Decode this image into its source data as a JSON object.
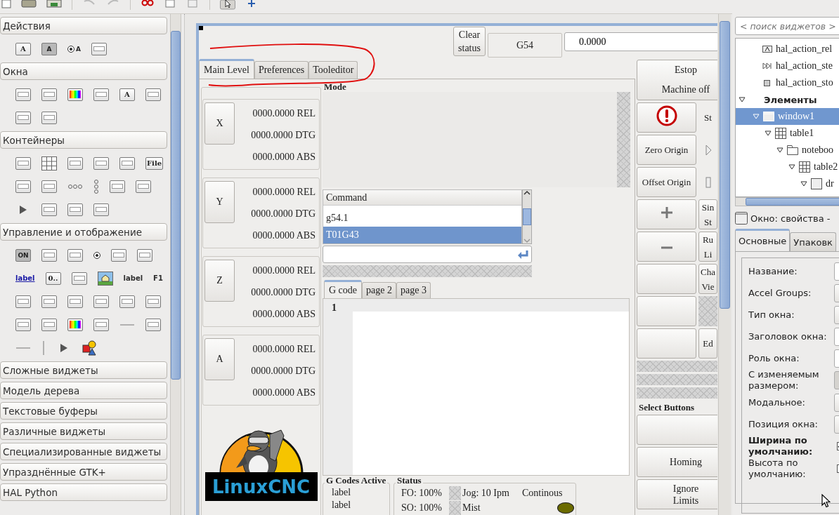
{
  "palette": {
    "groups": [
      {
        "title": "Действия",
        "rows": [
          [
            {
              "kind": "letter",
              "text": "A"
            },
            {
              "kind": "letter-shaded",
              "text": "A"
            },
            {
              "kind": "radio",
              "text": "A"
            },
            {
              "kind": "frame"
            }
          ]
        ]
      },
      {
        "title": "Окна",
        "rows": [
          [
            {
              "kind": "frame"
            },
            {
              "kind": "frame"
            },
            {
              "kind": "colors"
            },
            {
              "kind": "frame"
            },
            {
              "kind": "letter",
              "text": "A"
            },
            {
              "kind": "frame"
            }
          ],
          [
            {
              "kind": "frame"
            },
            {
              "kind": "frame"
            }
          ]
        ]
      },
      {
        "title": "Контейнеры",
        "rows": [
          [
            {
              "kind": "frame"
            },
            {
              "kind": "grid"
            },
            {
              "kind": "frame"
            },
            {
              "kind": "frame"
            },
            {
              "kind": "frame"
            },
            {
              "kind": "letter",
              "text": "File"
            }
          ],
          [
            {
              "kind": "frame"
            },
            {
              "kind": "frame"
            },
            {
              "kind": "dots"
            },
            {
              "kind": "vdots"
            },
            {
              "kind": "frame"
            },
            {
              "kind": "frame"
            }
          ],
          [
            {
              "kind": "arrow"
            },
            {
              "kind": "frame"
            },
            {
              "kind": "frame"
            },
            {
              "kind": "frame"
            }
          ]
        ]
      },
      {
        "title": "Управление и отображение",
        "rows": [
          [
            {
              "kind": "letter-shaded",
              "text": "ON"
            },
            {
              "kind": "frame"
            },
            {
              "kind": "frame"
            },
            {
              "kind": "radio",
              "text": ""
            },
            {
              "kind": "frame"
            },
            {
              "kind": "frame"
            }
          ],
          [
            {
              "kind": "link",
              "text": "label"
            },
            {
              "kind": "letter",
              "text": "0.."
            },
            {
              "kind": "frame"
            },
            {
              "kind": "image"
            },
            {
              "kind": "plain",
              "text": "label"
            },
            {
              "kind": "plain",
              "text": "F1"
            }
          ],
          [
            {
              "kind": "frame"
            },
            {
              "kind": "frame"
            },
            {
              "kind": "frame"
            },
            {
              "kind": "frame"
            },
            {
              "kind": "frame"
            },
            {
              "kind": "frame"
            }
          ],
          [
            {
              "kind": "frame"
            },
            {
              "kind": "frame"
            },
            {
              "kind": "colors"
            },
            {
              "kind": "frame"
            },
            {
              "kind": "hline"
            },
            {
              "kind": "frame"
            }
          ],
          [
            {
              "kind": "hline"
            },
            {
              "kind": "vline"
            },
            {
              "kind": "arrow"
            },
            {
              "kind": "shapes"
            }
          ]
        ]
      },
      {
        "title": "Сложные виджеты"
      },
      {
        "title": "Модель дерева"
      },
      {
        "title": "Текстовые буферы"
      },
      {
        "title": "Различные виджеты"
      },
      {
        "title": "Специализированные виджеты"
      },
      {
        "title": "Упразднённые GTK+"
      },
      {
        "title": "HAL Python"
      }
    ]
  },
  "cnc": {
    "clear_status": "Clear status",
    "coordinate_system": "G54",
    "value": "0.0000",
    "tabs": [
      {
        "label": "Main Level",
        "selected": true
      },
      {
        "label": "Preferences",
        "selected": false
      },
      {
        "label": "Tooleditor",
        "selected": false
      }
    ],
    "axes": [
      {
        "name": "X",
        "readings": [
          {
            "value": "0000.0000",
            "unit": "REL"
          },
          {
            "value": "0000.0000",
            "unit": "DTG"
          },
          {
            "value": "0000.0000",
            "unit": "ABS"
          }
        ]
      },
      {
        "name": "Y",
        "readings": [
          {
            "value": "0000.0000",
            "unit": "REL"
          },
          {
            "value": "0000.0000",
            "unit": "DTG"
          },
          {
            "value": "0000.0000",
            "unit": "ABS"
          }
        ]
      },
      {
        "name": "Z",
        "readings": [
          {
            "value": "0000.0000",
            "unit": "REL"
          },
          {
            "value": "0000.0000",
            "unit": "DTG"
          },
          {
            "value": "0000.0000",
            "unit": "ABS"
          }
        ]
      },
      {
        "name": "A",
        "readings": [
          {
            "value": "0000.0000",
            "unit": "REL"
          },
          {
            "value": "0000.0000",
            "unit": "DTG"
          },
          {
            "value": "0000.0000",
            "unit": "ABS"
          }
        ]
      }
    ],
    "logo": "LinuxCNC",
    "mode_title": "Mode",
    "command": {
      "header": "Command",
      "rows": [
        {
          "text": "g54.1",
          "selected": false
        },
        {
          "text": "T01G43",
          "selected": true
        }
      ]
    },
    "editor_tabs": [
      {
        "label": "G code",
        "selected": true
      },
      {
        "label": "page 2",
        "selected": false
      },
      {
        "label": "page 3",
        "selected": false
      }
    ],
    "line_numbers": [
      "1"
    ],
    "gcodes_active": {
      "title": "G Codes Active",
      "labels": [
        "label",
        "label"
      ]
    },
    "status": {
      "title": "Status",
      "fo": "FO: 100%",
      "so": "SO: 100%",
      "jog": "Jog: 10 Ipm",
      "jog_mode": "Continous",
      "mist": {
        "label": "Mist",
        "color": "#6b6b00"
      }
    },
    "estop": {
      "lines": [
        "Estop",
        "Machine off"
      ]
    },
    "side_rows": [
      {
        "main": {
          "kind": "alert"
        },
        "side": {
          "kind": "label",
          "text": "St"
        }
      },
      {
        "main": {
          "kind": "button",
          "lines": [
            "Zero Origin"
          ]
        },
        "side": {
          "kind": "play"
        }
      },
      {
        "main": {
          "kind": "button",
          "lines": [
            "Offset Origin"
          ]
        },
        "side": {
          "kind": "pause"
        }
      },
      {
        "main": {
          "kind": "plus"
        },
        "side": {
          "kind": "button",
          "lines": [
            "Sin",
            "St"
          ]
        }
      },
      {
        "main": {
          "kind": "minus"
        },
        "side": {
          "kind": "button",
          "lines": [
            "Ru",
            "Li"
          ]
        }
      },
      {
        "main": {
          "kind": "blank"
        },
        "side": {
          "kind": "button",
          "lines": [
            "Cha",
            "Vie"
          ]
        }
      },
      {
        "main": {
          "kind": "blank"
        },
        "side": {
          "kind": "placeholder"
        }
      },
      {
        "main": {
          "kind": "blank"
        },
        "side": {
          "kind": "button",
          "lines": [
            "Ed"
          ]
        }
      }
    ],
    "select_title": "Select Buttons",
    "select_buttons": [
      {
        "kind": "blank"
      },
      {
        "kind": "button",
        "lines": [
          "Homing"
        ]
      },
      {
        "kind": "button",
        "lines": [
          "Ignore",
          "Limits"
        ]
      }
    ]
  },
  "inspector": {
    "search_placeholder": "< поиск виджетов >",
    "tree": {
      "items": [
        {
          "kind": "label",
          "text": "hal_action_rel"
        },
        {
          "kind": "step",
          "text": "hal_action_ste"
        },
        {
          "kind": "stop",
          "text": "hal_action_sto"
        }
      ],
      "section": {
        "title": "Элементы",
        "expanded": true
      },
      "nodes": [
        {
          "label": "window1",
          "kind": "window",
          "expanded": true,
          "selected": true,
          "children": [
            {
              "label": "table1",
              "kind": "table",
              "expanded": true,
              "selected": false,
              "children": [
                {
                  "label": "noteboo",
                  "kind": "notebook",
                  "expanded": true,
                  "selected": false,
                  "children": [
                    {
                      "label": "table2",
                      "kind": "table",
                      "expanded": true,
                      "selected": false,
                      "children": [
                        {
                          "label": "dr",
                          "kind": "area",
                          "expanded": true,
                          "selected": false
                        }
                      ]
                    }
                  ]
                }
              ]
            }
          ]
        }
      ]
    },
    "properties_title": "Окно: свойства -",
    "tabs": [
      {
        "label": "Основные",
        "selected": true
      },
      {
        "label": "Упаковк",
        "selected": false
      }
    ],
    "properties": [
      {
        "label": "Название:",
        "kind": "field",
        "bold": false
      },
      {
        "label": "Accel Groups:",
        "kind": "button",
        "bold": false
      },
      {
        "label": "Тип окна:",
        "kind": "combo",
        "bold": false
      },
      {
        "label": "Заголовок окна:",
        "kind": "field",
        "bold": false
      },
      {
        "label": "Роль окна:",
        "kind": "field",
        "bold": false
      },
      {
        "label": "С изменяемым размером:",
        "kind": "toggle",
        "bold": false
      },
      {
        "label": "Модальное:",
        "kind": "button",
        "bold": false
      },
      {
        "label": "Позиция окна:",
        "kind": "combo",
        "bold": false
      },
      {
        "label": "Ширина по умолчанию:",
        "kind": "check",
        "checked": true,
        "bold": true
      },
      {
        "label": "Высота по умолчанию:",
        "kind": "check",
        "checked": false,
        "bold": false
      }
    ]
  }
}
